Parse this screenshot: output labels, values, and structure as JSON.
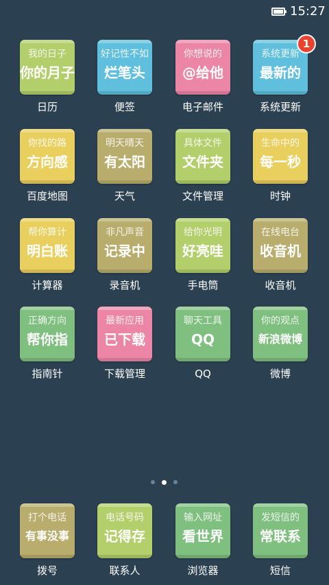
{
  "status_bar": {
    "time": "15:27",
    "icons": [
      "battery-icon"
    ]
  },
  "apps": [
    {
      "line1": "我的日子",
      "line2": "你的月子",
      "label": "日历",
      "color": "#b2cf6b"
    },
    {
      "line1": "好记性不如",
      "line2": "烂笔头",
      "label": "便签",
      "color": "#5fbfdc"
    },
    {
      "line1": "你想说的",
      "line2": "@给他",
      "label": "电子邮件",
      "color": "#ec86a6"
    },
    {
      "line1": "系统更新",
      "line2": "最新的",
      "label": "系统更新",
      "color": "#5fbfdc",
      "badge": "1"
    },
    {
      "line1": "你找的路",
      "line2": "方向感",
      "label": "百度地图",
      "color": "#e9cf5e"
    },
    {
      "line1": "明天晴天",
      "line2": "有太阳",
      "label": "天气",
      "color": "#b8ad6d"
    },
    {
      "line1": "具体文件",
      "line2": "文件夹",
      "label": "文件管理",
      "color": "#b2cf6b"
    },
    {
      "line1": "生命中的",
      "line2": "每一秒",
      "label": "时钟",
      "color": "#e9cf5e"
    },
    {
      "line1": "帮你算计",
      "line2": "明白账",
      "label": "计算器",
      "color": "#e9cf5e"
    },
    {
      "line1": "非凡声音",
      "line2": "记录中",
      "label": "录音机",
      "color": "#b8ad6d"
    },
    {
      "line1": "给你光明",
      "line2": "好亮哇",
      "label": "手电筒",
      "color": "#b2cf6b"
    },
    {
      "line1": "在线电台",
      "line2": "收音机",
      "label": "收音机",
      "color": "#b8ad6d"
    },
    {
      "line1": "正确方向",
      "line2": "帮你指",
      "label": "指南针",
      "color": "#7fbf7f"
    },
    {
      "line1": "最新应用",
      "line2": "已下载",
      "label": "下载管理",
      "color": "#ec86a6"
    },
    {
      "line1": "聊天工具",
      "line2": "QQ",
      "label": "QQ",
      "color": "#7fbf7f"
    },
    {
      "line1": "你的观点",
      "line2": "新浪微博",
      "label": "微博",
      "color": "#7fbf7f",
      "small": true
    }
  ],
  "page_indicator": {
    "count": 3,
    "active": 1
  },
  "dock": [
    {
      "line1": "打个电话",
      "line2": "有事没事",
      "label": "拨号",
      "color": "#b8ad6d",
      "small": true
    },
    {
      "line1": "电话号码",
      "line2": "记得存",
      "label": "联系人",
      "color": "#b2cf6b"
    },
    {
      "line1": "输入网址",
      "line2": "看世界",
      "label": "浏览器",
      "color": "#7fbf7f"
    },
    {
      "line1": "发短信的",
      "line2": "常联系",
      "label": "短信",
      "color": "#7fbf7f"
    }
  ]
}
